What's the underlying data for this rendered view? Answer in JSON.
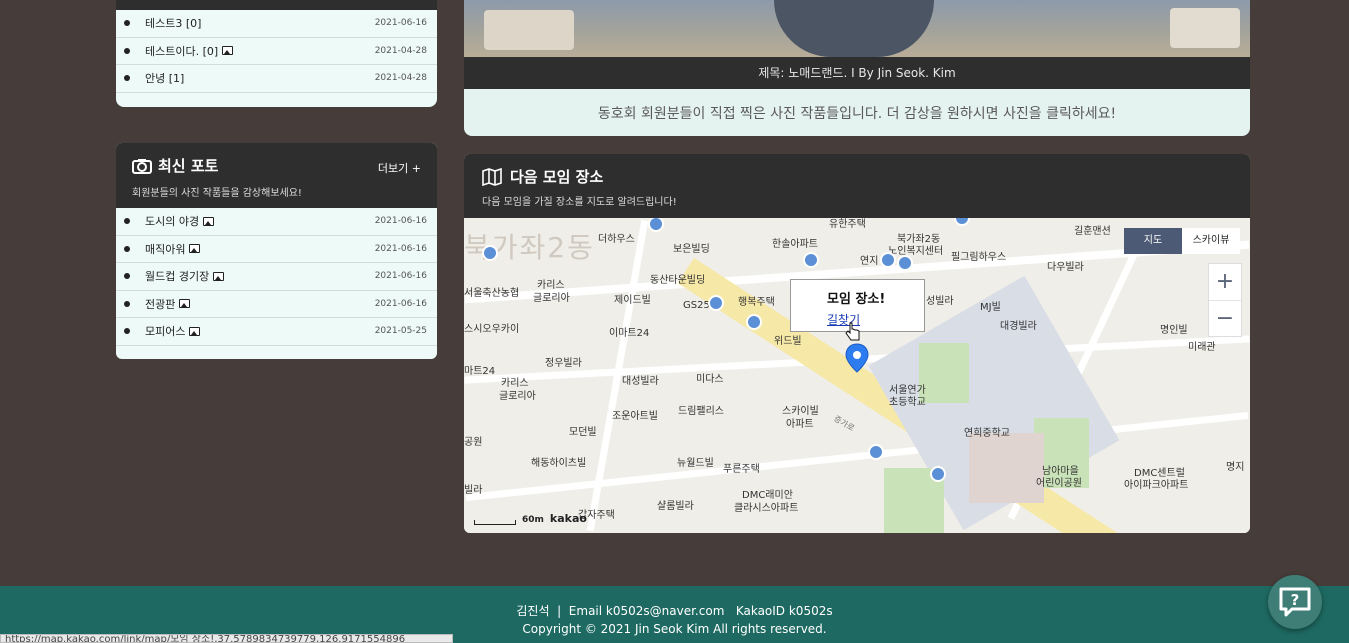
{
  "recent_posts": {
    "items": [
      {
        "name": "테스트3 [0]",
        "date": "2021-06-16",
        "has_image": false
      },
      {
        "name": "테스트이다. [0]",
        "date": "2021-04-28",
        "has_image": true
      },
      {
        "name": "안녕 [1]",
        "date": "2021-04-28",
        "has_image": false
      }
    ]
  },
  "photos": {
    "title": "최신 포토",
    "subtitle": "회원분들의 사진 작품들을 감상해보세요!",
    "more": "더보기 +",
    "items": [
      {
        "name": "도시의 야경",
        "date": "2021-06-16"
      },
      {
        "name": "매직아워",
        "date": "2021-06-16"
      },
      {
        "name": "월드컵 경기장",
        "date": "2021-06-16"
      },
      {
        "name": "전광판",
        "date": "2021-06-16"
      },
      {
        "name": "모피어스",
        "date": "2021-05-25"
      }
    ]
  },
  "featured_photo": {
    "caption": "제목: 노매드랜드. I    By Jin Seok. Kim",
    "description": "동호회 회원분들이 직접 찍은 사진 작품들입니다. 더 감상을 원하시면 사진을 클릭하세요!"
  },
  "map": {
    "title": "다음 모임 장소",
    "subtitle": "다음 모임을 가질 장소를 지도로 알려드립니다!",
    "toggle_map": "지도",
    "toggle_sky": "스카이뷰",
    "zoom_in": "+",
    "zoom_out": "−",
    "info_title": "모임 장소!",
    "info_link": "길찾기",
    "scale": "60m",
    "logo": "kakao",
    "labels": {
      "l1": "더하우스",
      "l2": "보은빌딩",
      "l3": "한솔아파트",
      "l4": "유한주택",
      "l5": "북가좌2동",
      "l6": "노인복지센터",
      "l7": "연지",
      "l8": "필그림하우스",
      "l9": "다우빌라",
      "l10": "길훈맨션",
      "l11": "카리스",
      "l12": "글로리아",
      "l13": "서울축산농협",
      "l14": "동산타운빌딩",
      "l15": "제이드빌",
      "l16": "GS25",
      "l17": "행복주택",
      "l18": "스시오우카이",
      "l19": "이마트24",
      "l20": "정우빌라",
      "l21": "위드빌",
      "l22": "성빌라",
      "l23": "MJ빌",
      "l24": "대경빌라",
      "l25": "명인빌",
      "l26": "미래관",
      "l27": "마트24",
      "l28": "대성빌라",
      "l29": "미다스",
      "l30": "서울연가",
      "l31": "초등학교",
      "l32": "조운아트빌",
      "l33": "드림팰리스",
      "l34": "스카이빌",
      "l35": "아파트",
      "l36": "모던빌",
      "l37": "연희중학교",
      "l38": "해동하이츠빌",
      "l39": "뉴월드빌",
      "l40": "푸른주택",
      "l41": "남아마을",
      "l42": "어린이공원",
      "l43": "DMC센트럴",
      "l44": "아이파크아파트",
      "l45": "DMC래미안",
      "l46": "클라시스아파트",
      "l47": "갑자주택",
      "l48": "샬롬빌라",
      "l49": "빌라",
      "l50": "공원",
      "l51": "증가로",
      "l52": "북가좌2동",
      "l53": "명지"
    }
  },
  "footer": {
    "line1": "김진석  |  Email k0502s@naver.com   KakaoID k0502s",
    "line2": "Copyright © 2021 Jin Seok Kim All rights reserved."
  },
  "status_url": "https://map.kakao.com/link/map/모임 장소!,37.5789834739779,126.9171554896"
}
